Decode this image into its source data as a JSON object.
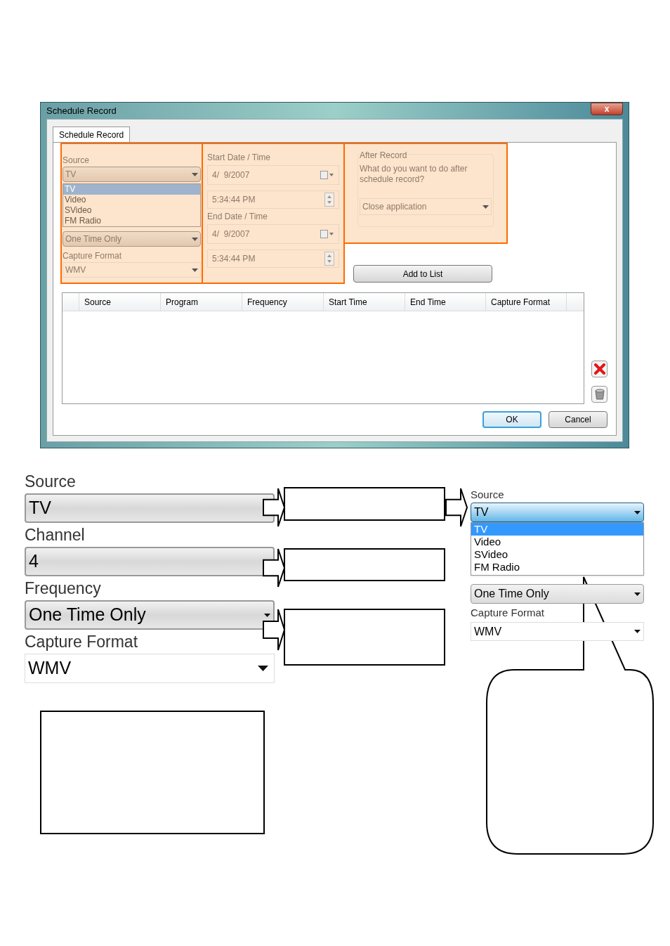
{
  "dialog": {
    "title": "Schedule Record",
    "close": "x",
    "tabs": [
      {
        "label": "Schedule Record",
        "selected": true
      }
    ],
    "source": {
      "label": "Source",
      "value": "TV",
      "options": [
        {
          "label": "TV",
          "selected": true
        },
        {
          "label": "Video",
          "selected": false
        },
        {
          "label": "SVideo",
          "selected": false
        },
        {
          "label": "FM Radio",
          "selected": false
        }
      ]
    },
    "frequency": {
      "value": "One Time Only"
    },
    "capture_format": {
      "label": "Capture Format",
      "value": "WMV"
    },
    "start": {
      "label": "Start Date / Time",
      "date": "4/  9/2007",
      "time": "5:34:44 PM"
    },
    "end": {
      "label": "End Date / Time",
      "date": "4/  9/2007",
      "time": "5:34:44 PM"
    },
    "after_record": {
      "label": "After Record",
      "question": "What do you want to do after schedule record?",
      "value": "Close application"
    },
    "add_button": "Add to List",
    "table": {
      "columns": [
        "Source",
        "Program",
        "Frequency",
        "Start Time",
        "End Time",
        "Capture Format"
      ]
    },
    "buttons": [
      {
        "label": "OK",
        "default": true
      },
      {
        "label": "Cancel",
        "default": false
      }
    ]
  },
  "zoomed_fields": [
    {
      "label": "Source",
      "value": "TV",
      "kind": "combo"
    },
    {
      "label": "Channel",
      "value": "4",
      "kind": "combo"
    },
    {
      "label": "Frequency",
      "value": "One Time Only",
      "kind": "combo"
    },
    {
      "label": "Capture Format",
      "value": "WMV",
      "kind": "plain"
    }
  ],
  "zoomed_dropdown": {
    "label": "Source",
    "value": "TV",
    "options": [
      {
        "label": "TV",
        "selected": true
      },
      {
        "label": "Video",
        "selected": false
      },
      {
        "label": "SVideo",
        "selected": false
      },
      {
        "label": "FM Radio",
        "selected": false
      }
    ],
    "frequency": "One Time Only",
    "capture_label": "Capture Format",
    "capture_value": "WMV"
  }
}
